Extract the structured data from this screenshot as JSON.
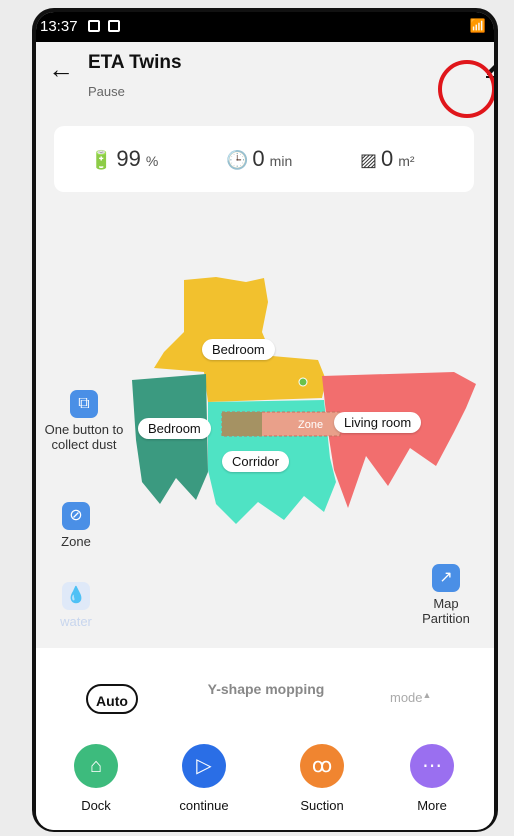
{
  "status_bar": {
    "time": "13:37"
  },
  "header": {
    "title": "ETA Twins",
    "subtitle": "Pause"
  },
  "stats": {
    "battery": {
      "value": "99",
      "unit": "%"
    },
    "time": {
      "value": "0",
      "unit": "min"
    },
    "area": {
      "value": "0",
      "unit": "m²"
    }
  },
  "map": {
    "rooms": {
      "bedroom_top": "Bedroom",
      "bedroom_left": "Bedroom",
      "corridor": "Corridor",
      "living_room": "Living room"
    },
    "zone_label": "Zone"
  },
  "side_tools": {
    "collect_dust": "One button to collect dust",
    "zone": "Zone",
    "water": "water",
    "map_partition": "Map Partition"
  },
  "controls": {
    "auto": "Auto",
    "y_shape": "Y-shape mopping",
    "mode": "mode"
  },
  "actions": {
    "dock": "Dock",
    "continue": "continue",
    "suction": "Suction",
    "more": "More"
  },
  "colors": {
    "bedroom_top": "#f2c12e",
    "bedroom_left": "#3b9a80",
    "corridor": "#4fe3c4",
    "living_room": "#f26e6e",
    "dock": "#3dbb7d",
    "continue": "#2a6ee6",
    "suction": "#f08530",
    "more": "#9a6ff0"
  }
}
